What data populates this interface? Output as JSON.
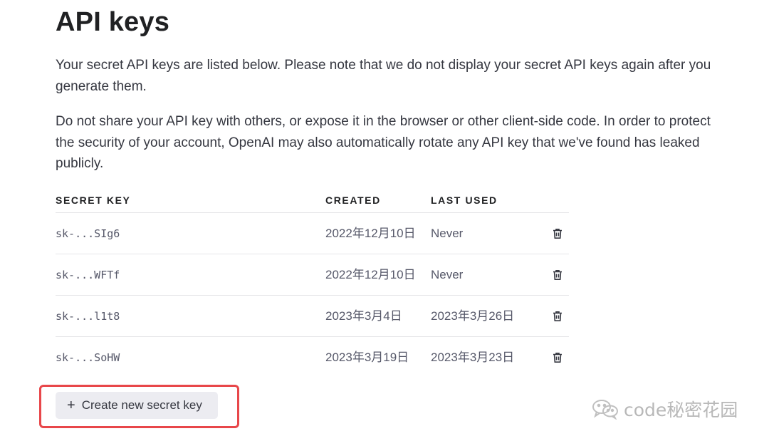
{
  "page": {
    "title": "API keys",
    "description_1": "Your secret API keys are listed below. Please note that we do not display your secret API keys again after you generate them.",
    "description_2": "Do not share your API key with others, or expose it in the browser or other client-side code. In order to protect the security of your account, OpenAI may also automatically rotate any API key that we've found has leaked publicly."
  },
  "table": {
    "headers": {
      "secret_key": "SECRET KEY",
      "created": "CREATED",
      "last_used": "LAST USED"
    },
    "rows": [
      {
        "key": "sk-...SIg6",
        "created": "2022年12月10日",
        "last_used": "Never"
      },
      {
        "key": "sk-...WFTf",
        "created": "2022年12月10日",
        "last_used": "Never"
      },
      {
        "key": "sk-...l1t8",
        "created": "2023年3月4日",
        "last_used": "2023年3月26日"
      },
      {
        "key": "sk-...SoHW",
        "created": "2023年3月19日",
        "last_used": "2023年3月23日"
      }
    ],
    "row_action_icon": "trash-icon"
  },
  "actions": {
    "create_label": "Create new secret key",
    "create_icon": "plus-icon"
  },
  "watermark": {
    "text": "code秘密花园",
    "icon": "wechat-logo"
  },
  "colors": {
    "highlight_border": "#e8474a",
    "button_bg": "#ececf1",
    "text_primary": "#202123",
    "text_secondary": "#565869"
  }
}
